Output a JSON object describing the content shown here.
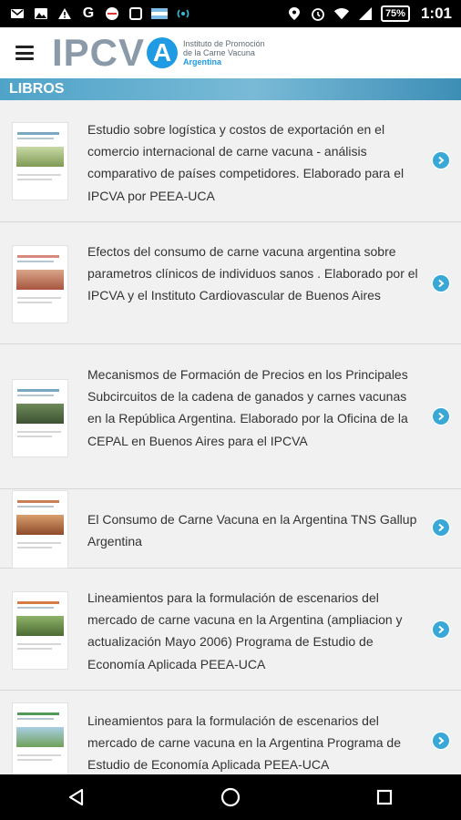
{
  "status_bar": {
    "time": "1:01",
    "battery": "75%",
    "left_icons": [
      "email-icon",
      "image-icon",
      "warning-icon",
      "google-icon",
      "no-sim-icon",
      "notification-icon",
      "argentina-flag-icon",
      "broadcast-icon"
    ],
    "right_icons": [
      "location-icon",
      "alarm-icon",
      "wifi-icon",
      "signal-icon"
    ]
  },
  "app": {
    "logo_text": "IPCV",
    "logo_circle_letter": "A",
    "logo_line1": "Instituto de Promoción",
    "logo_line2": "de la Carne Vacuna",
    "logo_country": "Argentina"
  },
  "section": {
    "title": "LIBROS"
  },
  "books": [
    {
      "title": "Estudio sobre logística y costos de exportación en el comercio internacional de carne vacuna - análisis comparativo de países competidores. Elaborado para el IPCVA por PEEA-UCA"
    },
    {
      "title": "Efectos del consumo de carne vacuna argentina sobre parametros clínicos de individuos sanos . Elaborado por el IPCVA y el Instituto Cardiovascular de Buenos Aires"
    },
    {
      "title": "Mecanismos de Formación de Precios en los Principales Subcircuitos de la cadena de ganados y carnes vacunas en la República Argentina. Elaborado por la Oficina de la CEPAL en Buenos Aires para el IPCVA"
    },
    {
      "title": "El Consumo de Carne Vacuna en la Argentina TNS Gallup Argentina"
    },
    {
      "title": "Lineamientos para la formulación de escenarios del mercado de carne vacuna en la Argentina (ampliacion y actualización Mayo 2006) Programa de Estudio de Economía Aplicada PEEA-UCA"
    },
    {
      "title": "Lineamientos para la formulación de escenarios del mercado de carne vacuna en la Argentina Programa de Estudio de Economía Aplicada PEEA-UCA"
    }
  ],
  "colors": {
    "accent": "#1e9be2",
    "section_bar": "#4fa3c8",
    "arrow": "#39a8d6"
  },
  "nav": {
    "icons": [
      "back-icon",
      "home-icon",
      "recents-icon"
    ]
  }
}
